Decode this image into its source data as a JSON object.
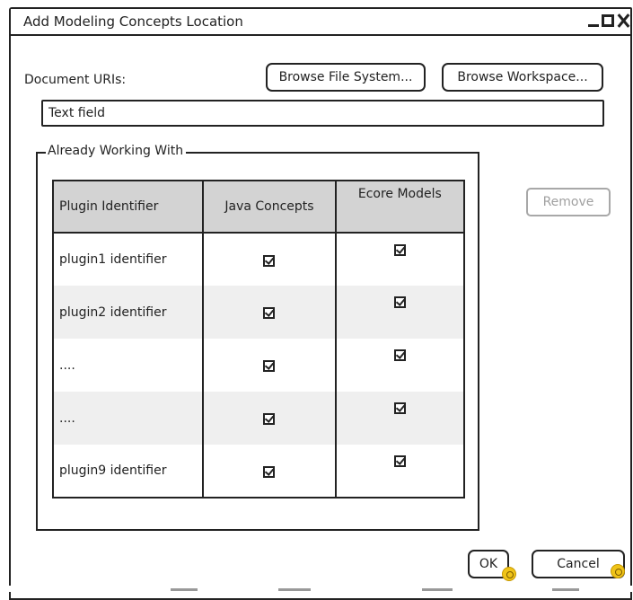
{
  "window": {
    "title": "Add Modeling Concepts Location"
  },
  "form": {
    "document_uris_label": "Document URIs:",
    "browse_file_system_label": "Browse File System...",
    "browse_workspace_label": "Browse Workspace...",
    "text_field_value": "Text field"
  },
  "group": {
    "legend": "Already Working With"
  },
  "table": {
    "headers": [
      "Plugin Identifier",
      "Java Concepts",
      "Ecore Models"
    ],
    "rows": [
      {
        "name": "plugin1 identifier",
        "java": true,
        "ecore": true
      },
      {
        "name": "plugin2 identifier",
        "java": true,
        "ecore": true
      },
      {
        "name": "....",
        "java": true,
        "ecore": true
      },
      {
        "name": "....",
        "java": true,
        "ecore": true
      },
      {
        "name": "plugin9 identifier",
        "java": true,
        "ecore": true
      }
    ]
  },
  "actions": {
    "remove_label": "Remove",
    "ok_label": "OK",
    "cancel_label": "Cancel"
  }
}
